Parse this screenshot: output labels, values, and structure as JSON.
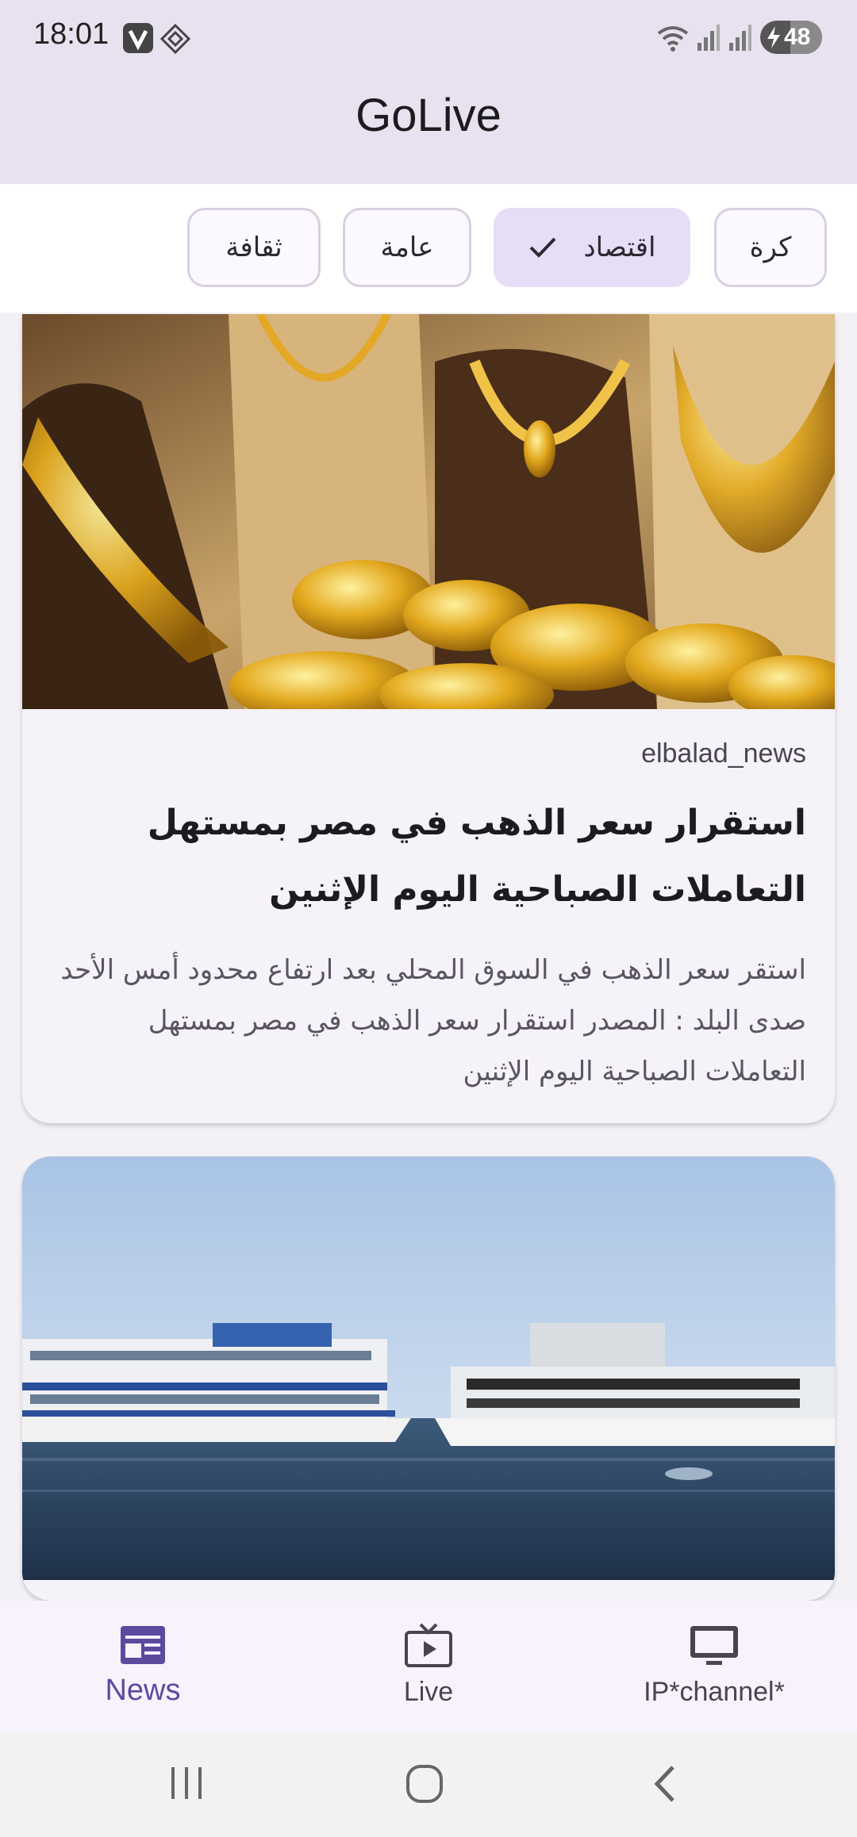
{
  "status_bar": {
    "time": "18:01",
    "battery": "48",
    "icons": [
      "vpn-icon",
      "app-icon",
      "wifi-icon",
      "signal-icon",
      "signal-icon",
      "battery-charging-icon"
    ]
  },
  "app": {
    "title": "GoLive"
  },
  "filters": [
    {
      "label": "كرة",
      "selected": false
    },
    {
      "label": "اقتصاد",
      "selected": true
    },
    {
      "label": "عامة",
      "selected": false
    },
    {
      "label": "ثقافة",
      "selected": false
    }
  ],
  "articles": [
    {
      "source": "elbalad_news",
      "headline": "استقرار سعر الذهب في مصر بمستهل التعاملات الصباحية اليوم الإثنين",
      "summary": "استقر سعر الذهب في السوق المحلي بعد ارتفاع محدود أمس الأحد صدى البلد : المصدر استقرار سعر الذهب في مصر بمستهل التعاملات الصباحية اليوم الإثنين",
      "image": "gold-jewelry-photo"
    },
    {
      "image": "nile-cruise-boats-photo"
    }
  ],
  "bottom_nav": [
    {
      "label": "News",
      "icon": "newspaper-icon",
      "active": true
    },
    {
      "label": "Live",
      "icon": "live-tv-icon",
      "active": false
    },
    {
      "label": "IP*channel*",
      "icon": "monitor-icon",
      "active": false
    }
  ],
  "colors": {
    "primary": "#5c4a9e",
    "top_bar": "#e8e2f0",
    "chip_selected": "#e6ddf6"
  }
}
